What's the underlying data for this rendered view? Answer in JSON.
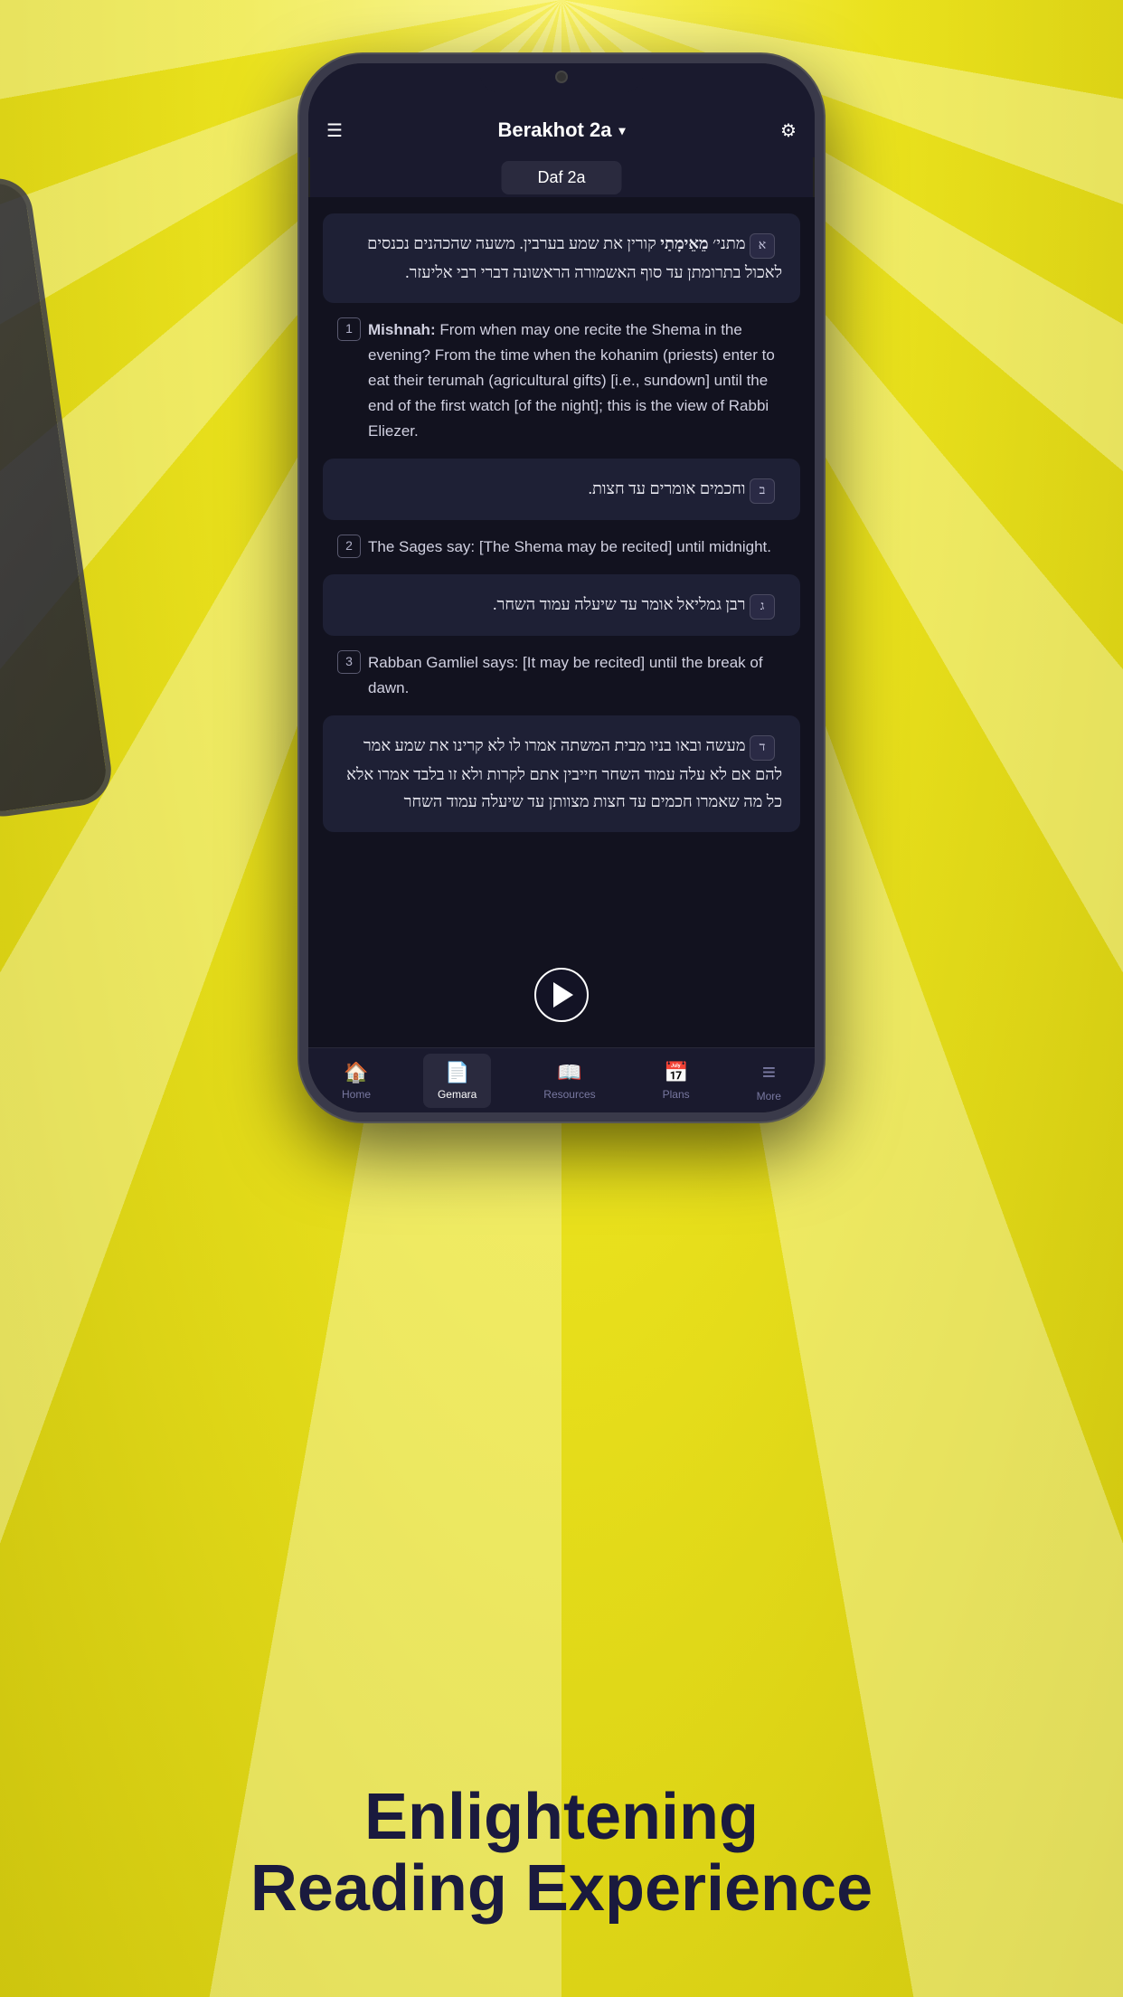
{
  "background": {
    "color": "#e8e020"
  },
  "phone": {
    "header": {
      "hamburger_label": "☰",
      "title": "Berakhot 2a",
      "chevron": "▾",
      "filter_label": "⊟"
    },
    "daf_label": "Daf 2a",
    "content": {
      "block1_hebrew": "מתני׳ מֵאֵימָתַי קורין את שמע בערבין. משעה שהכהנים נכנסים לאכול בתרומתן עד סוף האשמורה הראשונה דברי רבי אליעזר.",
      "block1_marker": "א",
      "block1_bold": "מֵאֵימָתַי",
      "block2_number": "1",
      "block2_english": "Mishnah: From when may one recite the Shema in the evening? From the time when the kohanim (priests) enter to eat their terumah (agricultural gifts) [i.e., sundown] until the end of the first watch [of the night]; this is the view of Rabbi Eliezer.",
      "block2_bold": "Mishnah:",
      "block3_marker": "ב",
      "block3_hebrew": "וחכמים אומרים עד חצות.",
      "block4_number": "2",
      "block4_english": "The Sages say: [The Shema may be recited] until midnight.",
      "block5_marker": "ג",
      "block5_hebrew": "רבן גמליאל אומר עד שיעלה עמוד השחר.",
      "block6_number": "3",
      "block6_english": "Rabban Gamliel says: [It may be recited] until the break of dawn.",
      "block7_marker": "ד",
      "block7_hebrew": "מעשה ובאו בניו מבית המשתה אמרו לו לא קרינו את שמע אמר להם אם לא עלה עמוד השחר חייבין אתם לקרות ולא זו בלבד אמרו אלא כל מה שאמרו חכמים עד חצות מצוותן עד שיעלה עמוד השחר"
    },
    "bottom_nav": {
      "items": [
        {
          "icon": "🏠",
          "label": "Home",
          "active": false
        },
        {
          "icon": "📄",
          "label": "Gemara",
          "active": true
        },
        {
          "icon": "📖",
          "label": "Resources",
          "active": false
        },
        {
          "icon": "📅",
          "label": "Plans",
          "active": false
        },
        {
          "icon": "≡",
          "label": "More",
          "active": false
        }
      ]
    }
  },
  "footer": {
    "line1": "Enlightening",
    "line2": "Reading Experience"
  }
}
